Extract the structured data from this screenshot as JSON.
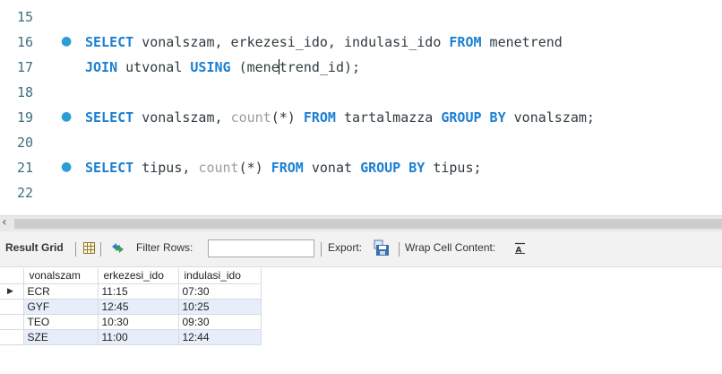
{
  "editor": {
    "lines": [
      {
        "num": "15",
        "marker": "",
        "tokens": []
      },
      {
        "num": "16",
        "marker": "●",
        "tokens": [
          {
            "t": "SELECT",
            "k": "kw"
          },
          {
            "t": " vonalszam, erkezesi_ido, indulasi_ido ",
            "k": "id"
          },
          {
            "t": "FROM",
            "k": "kw"
          },
          {
            "t": " menetrend",
            "k": "id"
          }
        ]
      },
      {
        "num": "17",
        "marker": "",
        "tokens": [
          {
            "t": "JOIN",
            "k": "kw"
          },
          {
            "t": " utvonal ",
            "k": "id"
          },
          {
            "t": "USING",
            "k": "kw"
          },
          {
            "t": " (mene",
            "k": "id"
          },
          {
            "t": "",
            "k": "caret"
          },
          {
            "t": "trend_id);",
            "k": "id"
          }
        ]
      },
      {
        "num": "18",
        "marker": "",
        "tokens": []
      },
      {
        "num": "19",
        "marker": "●",
        "tokens": [
          {
            "t": "SELECT",
            "k": "kw"
          },
          {
            "t": " vonalszam, ",
            "k": "id"
          },
          {
            "t": "count",
            "k": "fn"
          },
          {
            "t": "(*) ",
            "k": "id"
          },
          {
            "t": "FROM",
            "k": "kw"
          },
          {
            "t": " tartalmazza ",
            "k": "id"
          },
          {
            "t": "GROUP BY",
            "k": "kw"
          },
          {
            "t": " vonalszam;",
            "k": "id"
          }
        ]
      },
      {
        "num": "20",
        "marker": "",
        "tokens": []
      },
      {
        "num": "21",
        "marker": "●",
        "tokens": [
          {
            "t": "SELECT",
            "k": "kw"
          },
          {
            "t": " tipus, ",
            "k": "id"
          },
          {
            "t": "count",
            "k": "fn"
          },
          {
            "t": "(*) ",
            "k": "id"
          },
          {
            "t": "FROM",
            "k": "kw"
          },
          {
            "t": " vonat ",
            "k": "id"
          },
          {
            "t": "GROUP BY",
            "k": "kw"
          },
          {
            "t": " tipus;",
            "k": "id"
          }
        ]
      },
      {
        "num": "22",
        "marker": "",
        "tokens": []
      }
    ],
    "colors": {
      "keyword": "#1c7fd1",
      "function": "#9a9da4",
      "identifier": "#2f3b40",
      "line_number": "#3f6f7d",
      "statement_marker": "#2a9fd6"
    }
  },
  "scrollbar": {
    "left_arrow": "‹"
  },
  "toolbar": {
    "result_grid_label": "Result Grid",
    "filter_rows_label": "Filter Rows:",
    "filter_value": "",
    "export_label": "Export:",
    "wrap_label": "Wrap Cell Content:",
    "icons": {
      "grid": "grid-icon",
      "filter": "filter-icon",
      "export": "export-icon",
      "wrap": "wrap-icon"
    }
  },
  "grid": {
    "columns": [
      "vonalszam",
      "erkezesi_ido",
      "indulasi_ido"
    ],
    "current_row_marker": "▶",
    "rows": [
      [
        "ECR",
        "11:15",
        "07:30"
      ],
      [
        "GYF",
        "12:45",
        "10:25"
      ],
      [
        "TEO",
        "10:30",
        "09:30"
      ],
      [
        "SZE",
        "11:00",
        "12:44"
      ]
    ]
  }
}
